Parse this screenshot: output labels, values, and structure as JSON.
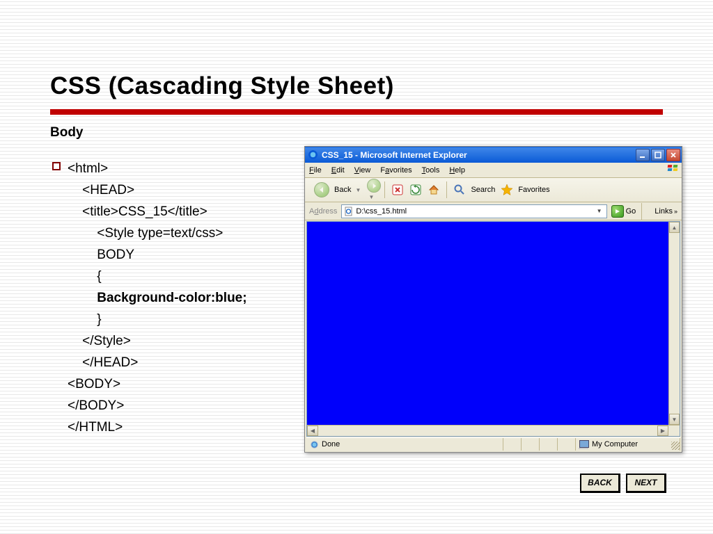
{
  "title": "CSS (Cascading Style Sheet)",
  "subheading": "Body",
  "code": {
    "l1": "<html>",
    "l2": "    <HEAD>",
    "l3": "    <title>CSS_15</title>",
    "l4": "        <Style type=text/css>",
    "l5": "        BODY",
    "l6": "        {",
    "l7": "        Background-color:blue;",
    "l8": "        }",
    "l9": "    </Style>",
    "l10": "    </HEAD>",
    "l11": "<BODY>",
    "l12": "</BODY>",
    "l13": "</HTML>"
  },
  "ie": {
    "window_title": "CSS_15 - Microsoft Internet Explorer",
    "menus": {
      "file": "File",
      "edit": "Edit",
      "view": "View",
      "favorites": "Favorites",
      "tools": "Tools",
      "help": "Help"
    },
    "toolbar": {
      "back": "Back",
      "search": "Search",
      "favorites": "Favorites"
    },
    "address": {
      "label": "Address",
      "path": "D:\\css_15.html",
      "go": "Go",
      "links": "Links"
    },
    "status": {
      "done": "Done",
      "zone": "My Computer"
    }
  },
  "nav": {
    "back": "BACK",
    "next": "NEXT"
  }
}
